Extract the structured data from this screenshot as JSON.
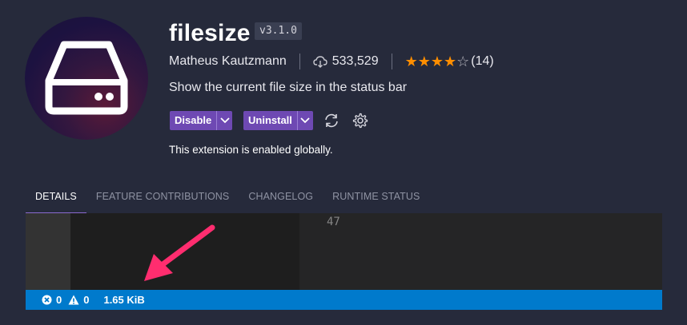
{
  "extension": {
    "name": "filesize",
    "version": "v3.1.0",
    "publisher": "Matheus Kautzmann",
    "installs": "533,529",
    "rating": {
      "stars": 4,
      "max": 5,
      "count": "(14)"
    },
    "description": "Show the current file size in the status bar",
    "logo_icon": "hard-drive-icon"
  },
  "actions": {
    "disable_label": "Disable",
    "uninstall_label": "Uninstall",
    "sync_icon": "sync-icon",
    "settings_icon": "gear-icon"
  },
  "status_message": "This extension is enabled globally.",
  "tabs": [
    {
      "label": "DETAILS",
      "active": true
    },
    {
      "label": "FEATURE CONTRIBUTIONS",
      "active": false
    },
    {
      "label": "CHANGELOG",
      "active": false
    },
    {
      "label": "RUNTIME STATUS",
      "active": false
    }
  ],
  "preview": {
    "line_number": "47",
    "statusbar": {
      "errors": "0",
      "warnings": "0",
      "file_size": "1.65 KiB"
    }
  },
  "colors": {
    "background": "#262a3b",
    "accent_button": "#6e49b3",
    "statusbar": "#007acc",
    "star": "#ff8e00",
    "annotation_arrow": "#ff2d6f"
  }
}
